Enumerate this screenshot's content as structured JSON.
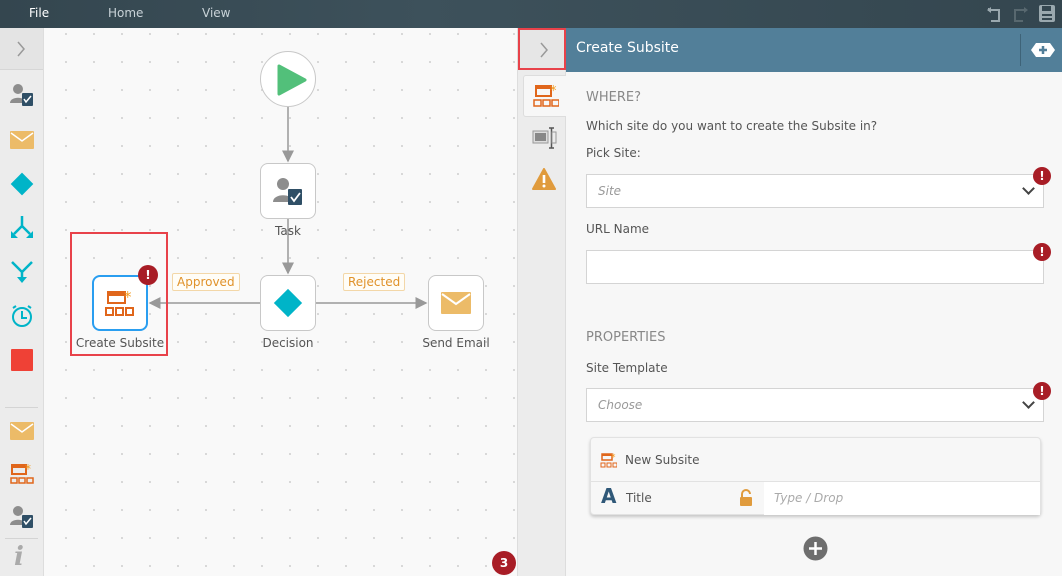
{
  "menu": {
    "file": "File",
    "home": "Home",
    "view": "View"
  },
  "canvas": {
    "nodes": {
      "task": "Task",
      "decision": "Decision",
      "create_subsite": "Create Subsite",
      "send_email": "Send Email"
    },
    "edges": {
      "approved": "Approved",
      "rejected": "Rejected"
    },
    "error_badge": "!",
    "issue_count": "3"
  },
  "panel": {
    "title": "Create Subsite",
    "where_heading": "WHERE?",
    "where_question": "Which site do you want to create the Subsite in?",
    "pick_site_label": "Pick Site:",
    "site_placeholder": "Site",
    "url_name_label": "URL Name",
    "url_name_value": "",
    "properties_heading": "PROPERTIES",
    "site_template_label": "Site Template",
    "site_template_placeholder": "Choose",
    "card_title": "New Subsite",
    "title_field_label": "Title",
    "title_placeholder": "Type / Drop",
    "error_mark": "!"
  },
  "colors": {
    "header": "#527f99",
    "accent_orange": "#e0661b",
    "teal": "#00b4c8",
    "error": "#a81d26",
    "highlight": "#e8424a"
  }
}
